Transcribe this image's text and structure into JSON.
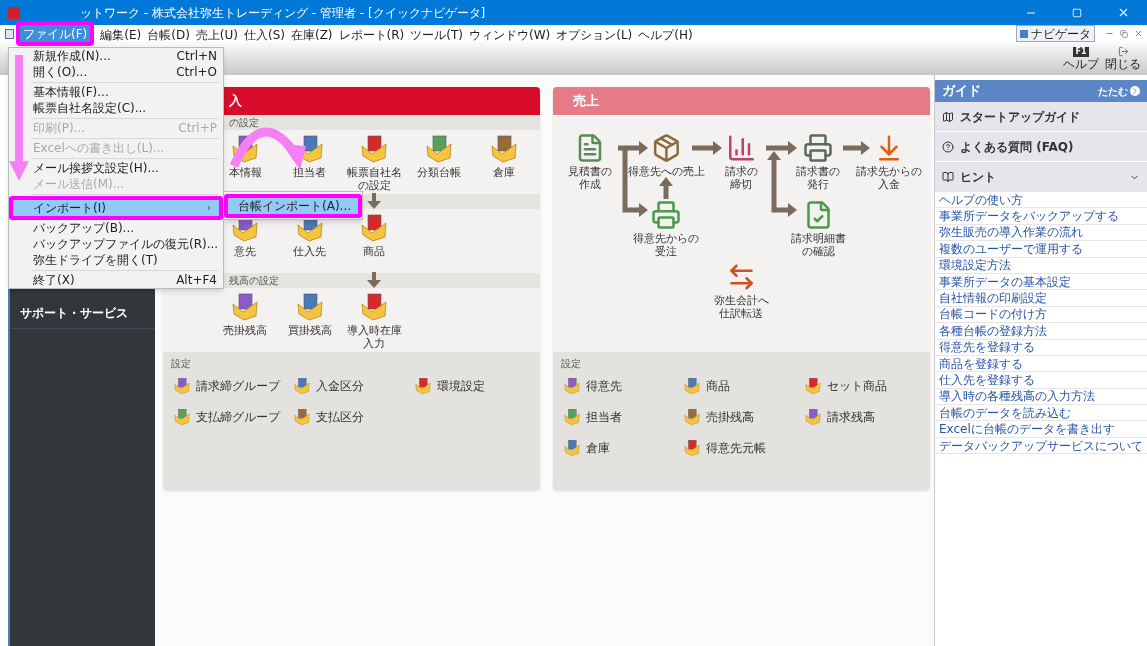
{
  "window": {
    "title": "ットワーク - 株式会社弥生トレーディング - 管理者 - [クイックナビゲータ]"
  },
  "menu_bar": {
    "items": [
      {
        "label": "ファイル(F)",
        "selected": true
      },
      {
        "label": "編集(E)",
        "selected": false
      },
      {
        "label": "台帳(D)",
        "selected": false
      },
      {
        "label": "売上(U)",
        "selected": false
      },
      {
        "label": "仕入(S)",
        "selected": false
      },
      {
        "label": "在庫(Z)",
        "selected": false
      },
      {
        "label": "レポート(R)",
        "selected": false
      },
      {
        "label": "ツール(T)",
        "selected": false
      },
      {
        "label": "ウィンドウ(W)",
        "selected": false
      },
      {
        "label": "オプション(L)",
        "selected": false
      },
      {
        "label": "ヘルプ(H)",
        "selected": false
      }
    ],
    "navigator": "ナビゲータ"
  },
  "toolbar": {
    "help_key": "F1",
    "help": "ヘルプ",
    "close": "閉じる"
  },
  "sidebar": {
    "items": [
      "サポート・サービス"
    ]
  },
  "purchase": {
    "title": "入",
    "sections": [
      {
        "header": "の設定",
        "items": [
          {
            "label": "本情報",
            "arrow_below": false
          },
          {
            "label": "担当者",
            "arrow_below": false
          },
          {
            "label": "帳票自社名の設定",
            "arrow_below": true
          },
          {
            "label": "分類台帳",
            "arrow_below": false
          },
          {
            "label": "倉庫",
            "arrow_below": false
          }
        ]
      },
      {
        "items": [
          {
            "label": "意先",
            "arrow_below": false
          },
          {
            "label": "仕入先",
            "arrow_below": false
          },
          {
            "label": "商品",
            "arrow_below": true
          }
        ]
      },
      {
        "header": "残高の設定",
        "items": [
          {
            "label": "売掛残高",
            "arrow_below": false
          },
          {
            "label": "買掛残高",
            "arrow_below": false
          },
          {
            "label": "導入時在庫入力",
            "arrow_below": false
          }
        ]
      }
    ],
    "settings": {
      "title": "設定",
      "rows": [
        [
          "請求締グループ",
          "入金区分",
          "環境設定"
        ],
        [
          "支払締グループ",
          "支払区分"
        ]
      ]
    }
  },
  "sales": {
    "title": "売上",
    "flow": [
      {
        "label": "見積書の作成"
      },
      {
        "label": "得意先への売上"
      },
      {
        "label": "請求の締切"
      },
      {
        "label": "請求書の発行"
      },
      {
        "label": "請求先からの入金"
      },
      {
        "label": "得意先からの受注"
      },
      {
        "label": "請求明細書の確認"
      },
      {
        "label": "弥生会計へ仕訳転送"
      }
    ],
    "settings": {
      "title": "設定",
      "rows": [
        [
          "得意先",
          "商品",
          "セット商品"
        ],
        [
          "担当者",
          "売掛残高",
          "請求残高"
        ],
        [
          "倉庫",
          "得意先元帳"
        ]
      ]
    }
  },
  "guide": {
    "title": "ガイド",
    "collapse": "たたむ",
    "sections": [
      {
        "label": "スタートアップガイド"
      },
      {
        "label": "よくある質問 (FAQ)"
      }
    ],
    "hint": {
      "label": "ヒント",
      "expanded": true
    },
    "links": [
      "ヘルプの使い方",
      "事業所データをバックアップする",
      "弥生販売の導入作業の流れ",
      "複数のユーザーで運用する",
      "環境設定方法",
      "事業所データの基本設定",
      "自社情報の印刷設定",
      "台帳コードの付け方",
      "各種台帳の登録方法",
      "得意先を登録する",
      "商品を登録する",
      "仕入先を登録する",
      "導入時の各種残高の入力方法",
      "台帳のデータを読み込む",
      "Excelに台帳のデータを書き出す",
      "データバックアップサービスについて"
    ]
  },
  "file_menu": {
    "items": [
      {
        "kind": "item",
        "label": "新規作成(N)...",
        "shortcut": "Ctrl+N",
        "disabled": false,
        "selected": false,
        "submenu": false
      },
      {
        "kind": "item",
        "label": "開く(O)...",
        "shortcut": "Ctrl+O",
        "disabled": false,
        "selected": false,
        "submenu": false
      },
      {
        "kind": "separator"
      },
      {
        "kind": "item",
        "label": "基本情報(F)...",
        "disabled": false,
        "selected": false,
        "submenu": false
      },
      {
        "kind": "item",
        "label": "帳票自社名設定(C)...",
        "disabled": false,
        "selected": false,
        "submenu": false
      },
      {
        "kind": "separator"
      },
      {
        "kind": "item",
        "label": "印刷(P)...",
        "shortcut": "Ctrl+P",
        "disabled": true,
        "selected": false,
        "submenu": false
      },
      {
        "kind": "separator"
      },
      {
        "kind": "item",
        "label": "Excelへの書き出し(L)...",
        "disabled": true,
        "selected": false,
        "submenu": false
      },
      {
        "kind": "separator"
      },
      {
        "kind": "item",
        "label": "メール挨拶文設定(H)...",
        "disabled": false,
        "selected": false,
        "submenu": false
      },
      {
        "kind": "item",
        "label": "メール送信(M)...",
        "disabled": true,
        "selected": false,
        "submenu": false
      },
      {
        "kind": "separator"
      },
      {
        "kind": "item",
        "label": "インポート(I)",
        "disabled": false,
        "selected": true,
        "submenu": true
      },
      {
        "kind": "item",
        "label": "バックアップ(B)...",
        "disabled": false,
        "selected": false,
        "submenu": false
      },
      {
        "kind": "item",
        "label": "バックアップファイルの復元(R)...",
        "disabled": false,
        "selected": false,
        "submenu": false
      },
      {
        "kind": "item",
        "label": "弥生ドライブを開く(T)",
        "disabled": false,
        "selected": false,
        "submenu": false
      },
      {
        "kind": "separator"
      },
      {
        "kind": "item",
        "label": "終了(X)",
        "shortcut": "Alt+F4",
        "disabled": false,
        "selected": false,
        "submenu": false
      }
    ],
    "submenu": [
      {
        "label": "台帳インポート(A)...",
        "selected": true
      }
    ]
  }
}
